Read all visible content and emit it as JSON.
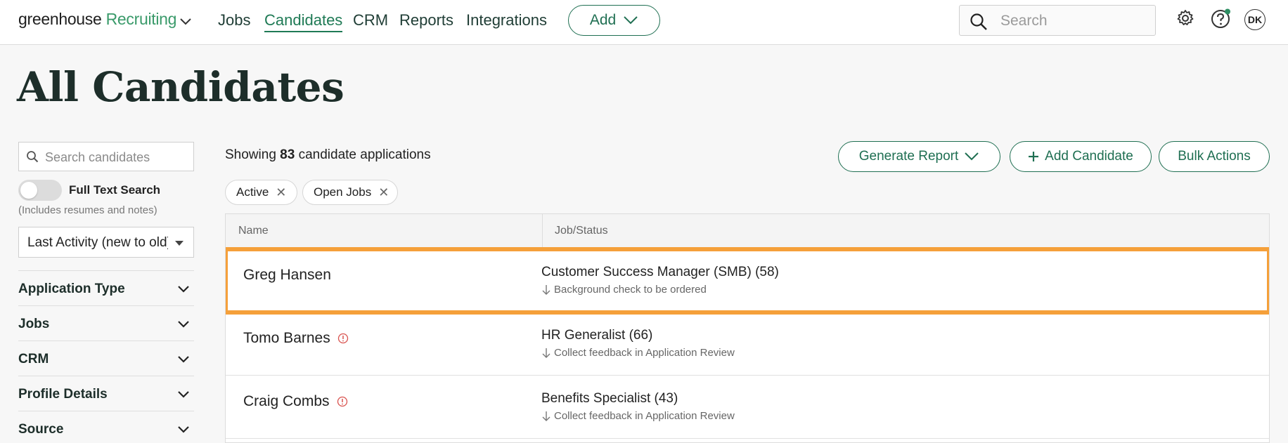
{
  "app": {
    "logo_word1": "greenhouse",
    "logo_word2": "Recruiting",
    "nav": [
      "Jobs",
      "Candidates",
      "CRM",
      "Reports",
      "Integrations"
    ],
    "active_nav": "Candidates",
    "add_label": "Add",
    "search_placeholder": "Search",
    "avatar_initials": "DK",
    "accent_color": "#1f6f52",
    "highlight_color": "#f5a03a"
  },
  "page": {
    "title": "All Candidates"
  },
  "sidebar": {
    "search_placeholder": "Search candidates",
    "full_text_label": "Full Text Search",
    "full_text_sub": "(Includes resumes and notes)",
    "full_text_enabled": false,
    "sort_value": "Last Activity (new to old)",
    "facets": [
      "Application Type",
      "Jobs",
      "CRM",
      "Profile Details",
      "Source"
    ]
  },
  "main": {
    "showing_prefix": "Showing",
    "showing_count": "83",
    "showing_suffix": "candidate applications",
    "buttons": {
      "generate_report": "Generate Report",
      "add_candidate": "Add Candidate",
      "bulk_actions": "Bulk Actions"
    },
    "filters": [
      "Active",
      "Open Jobs"
    ],
    "columns": [
      "Name",
      "Job/Status"
    ],
    "rows": [
      {
        "name": "Greg Hansen",
        "warning": false,
        "job": "Customer Success Manager (SMB) (58)",
        "status": "Background check to be ordered",
        "highlighted": true
      },
      {
        "name": "Tomo Barnes",
        "warning": true,
        "job": "HR Generalist (66)",
        "status": "Collect feedback in Application Review",
        "highlighted": false
      },
      {
        "name": "Craig Combs",
        "warning": true,
        "job": "Benefits Specialist (43)",
        "status": "Collect feedback in Application Review",
        "highlighted": false
      }
    ]
  }
}
